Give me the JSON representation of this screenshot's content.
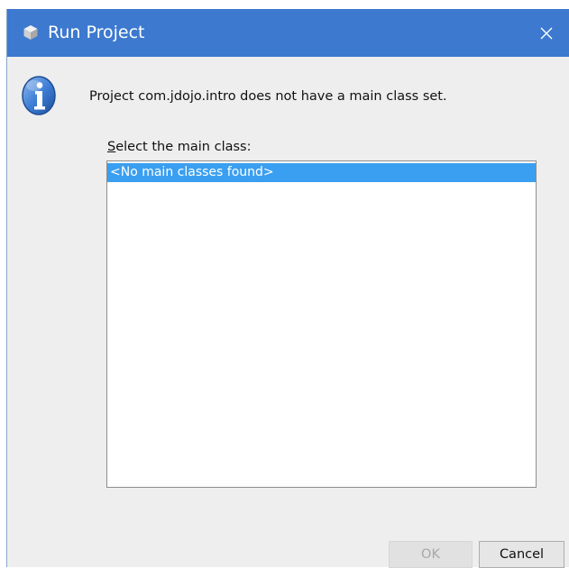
{
  "window": {
    "title": "Run Project",
    "close_icon": "close-icon",
    "app_icon": "cube-icon"
  },
  "message": {
    "icon": "info-icon",
    "text": "Project com.jdojo.intro does not have a main class set."
  },
  "main_class_list": {
    "label_mnemonic": "S",
    "label_rest": "elect the main class:",
    "items": [
      "<No main classes found>"
    ],
    "selected_index": 0
  },
  "buttons": {
    "ok_label": "OK",
    "ok_enabled": false,
    "cancel_label": "Cancel"
  },
  "colors": {
    "titlebar": "#3c79cf",
    "selection": "#3a9ff0",
    "dialog_bg": "#eeeeee"
  }
}
